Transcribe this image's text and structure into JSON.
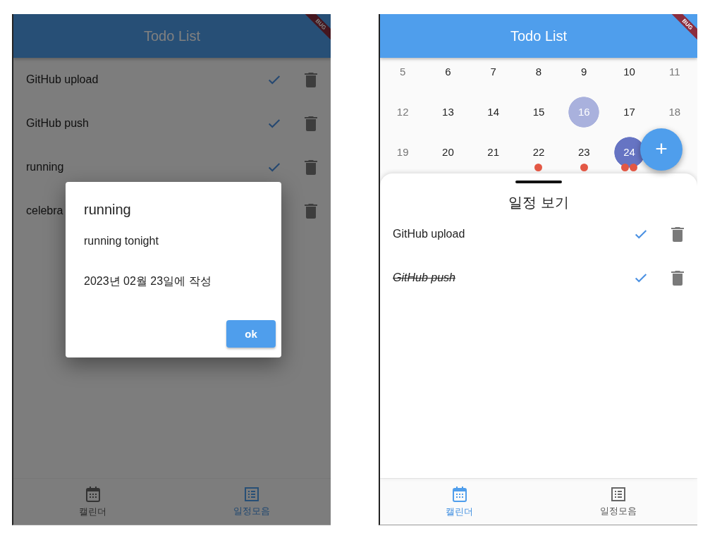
{
  "screens": [
    {
      "kind": "list",
      "app_bar": {
        "title": "Todo List"
      },
      "debug_banner": "BUG",
      "todos": [
        {
          "title": "GitHub upload",
          "done": false
        },
        {
          "title": "GitHub push",
          "done": false
        },
        {
          "title": "running",
          "done": false
        },
        {
          "title": "celebra",
          "done": false,
          "covered": true
        }
      ],
      "dialog": {
        "title": "running",
        "body": "running tonight",
        "meta": "2023년 02월 23일에 작성",
        "button": "ok"
      },
      "nav": [
        {
          "label": "캘린더",
          "selected": false
        },
        {
          "label": "일정모음",
          "selected": true
        }
      ]
    },
    {
      "kind": "calendar",
      "app_bar": {
        "title": "Todo List"
      },
      "debug_banner": "BUG",
      "calendar": {
        "weeks": [
          [
            {
              "day": "5",
              "weekend": true,
              "today": false,
              "selected": false
            },
            {
              "day": "6",
              "weekend": false,
              "today": false,
              "selected": false
            },
            {
              "day": "7",
              "weekend": false,
              "today": false,
              "selected": false
            },
            {
              "day": "8",
              "weekend": false,
              "today": false,
              "selected": false
            },
            {
              "day": "9",
              "weekend": false,
              "today": false,
              "selected": false
            },
            {
              "day": "10",
              "weekend": false,
              "today": false,
              "selected": false
            },
            {
              "day": "11",
              "weekend": true,
              "today": false,
              "selected": false
            }
          ],
          [
            {
              "day": "12",
              "weekend": true,
              "today": false,
              "selected": false
            },
            {
              "day": "13",
              "weekend": false,
              "today": false,
              "selected": false
            },
            {
              "day": "14",
              "weekend": false,
              "today": false,
              "selected": false
            },
            {
              "day": "15",
              "weekend": false,
              "today": false,
              "selected": false
            },
            {
              "day": "16",
              "weekend": false,
              "today": true,
              "selected": false
            },
            {
              "day": "17",
              "weekend": false,
              "today": false,
              "selected": false
            },
            {
              "day": "18",
              "weekend": true,
              "today": false,
              "selected": false
            }
          ],
          [
            {
              "day": "19",
              "weekend": true,
              "today": false,
              "selected": false
            },
            {
              "day": "20",
              "weekend": false,
              "today": false,
              "selected": false
            },
            {
              "day": "21",
              "weekend": false,
              "today": false,
              "selected": false
            },
            {
              "day": "22",
              "weekend": false,
              "today": false,
              "selected": false,
              "markers": [
                {
                  "color": "#e35845"
                }
              ]
            },
            {
              "day": "23",
              "weekend": false,
              "today": false,
              "selected": false,
              "markers": [
                {
                  "color": "#e35845"
                }
              ]
            },
            {
              "day": "24",
              "weekend": false,
              "today": false,
              "selected": true,
              "markers": [
                {
                  "color": "#e35845"
                },
                {
                  "color": "#e35845"
                }
              ]
            }
          ]
        ]
      },
      "fab": {
        "label": "+"
      },
      "sheet": {
        "title": "일정 보기",
        "todos": [
          {
            "title": "GitHub upload",
            "done": false
          },
          {
            "title": "GitHub push",
            "done": true
          }
        ]
      },
      "nav": [
        {
          "label": "캘린더",
          "selected": true
        },
        {
          "label": "일정모음",
          "selected": false
        }
      ]
    }
  ]
}
